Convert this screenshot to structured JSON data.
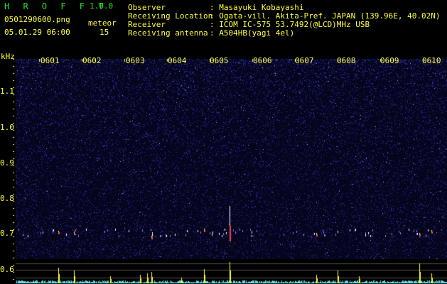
{
  "header": {
    "app_name": "H R O F F T",
    "version": "1.0.0",
    "filename": "0501290600.png",
    "timestamp": "05.01.29 06:00",
    "meteor_label": "meteor",
    "meteor_count": "15",
    "info": [
      {
        "label": "Observer",
        "value": ": Masayuki Kobayashi"
      },
      {
        "label": "Receiving Location",
        "value": ": Ogata-vill. Akita-Pref. JAPAN (139.96E, 40.02N)"
      },
      {
        "label": "Receiver",
        "value": ": ICOM IC-575 53.7492(@LCD)MHz USB"
      },
      {
        "label": "Receiving antenna",
        "value": ": A504HB(yagi 4el)"
      }
    ]
  },
  "axis": {
    "unit": "kHz",
    "y_ticks": [
      "1.1",
      "1.0",
      "0.9",
      "0.8",
      "0.7",
      "0.6"
    ],
    "minute_labels": [
      "0601",
      "0602",
      "0603",
      "0604",
      "0605",
      "0606",
      "0607",
      "0608",
      "0609",
      "0610"
    ]
  },
  "colors": {
    "background": "#000000",
    "title": "#27e327",
    "minute_labels": "#ffff40",
    "text": "#ffffff",
    "noise": "#2a2aa8",
    "level_trace": "#5fe0e0",
    "meteor_spike": "#ffff40"
  }
}
